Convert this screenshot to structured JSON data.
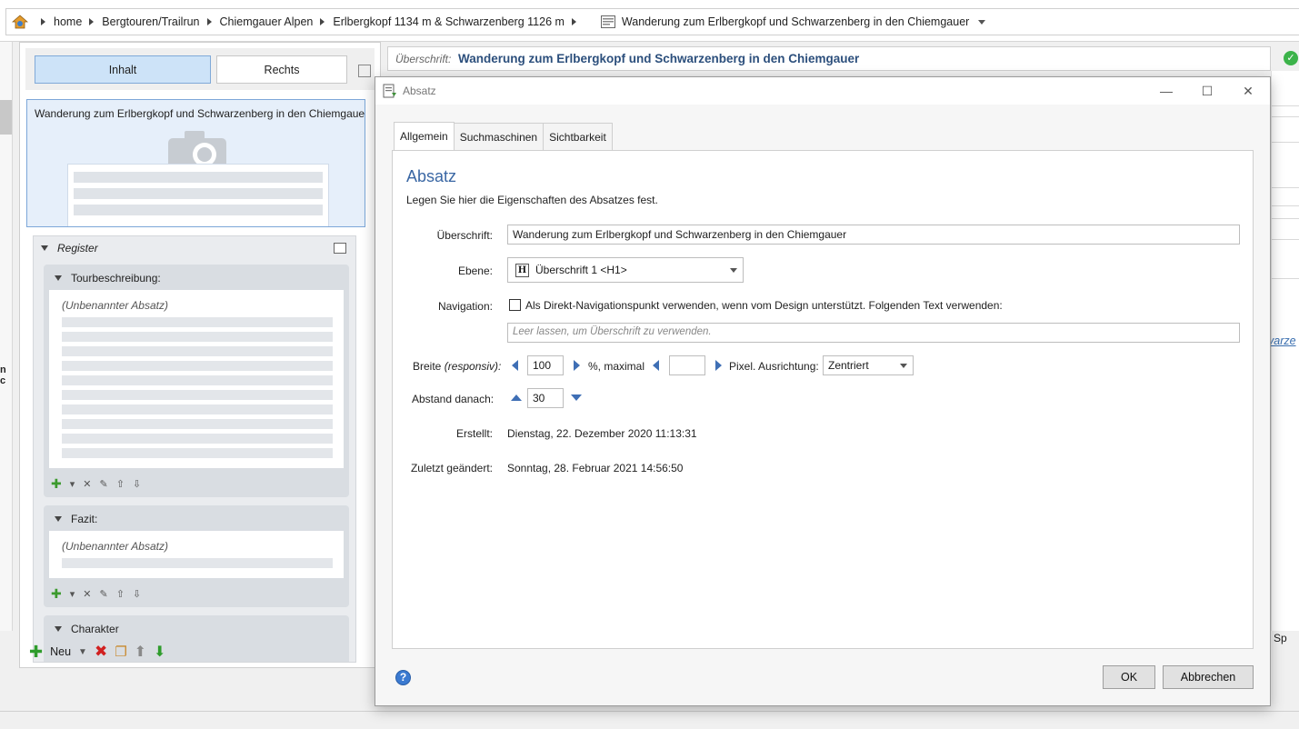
{
  "breadcrumb": {
    "items": [
      "home",
      "Bergtouren/Trailrun",
      "Chiemgauer Alpen",
      "Erlbergkopf 1134 m & Schwarzenberg 1126 m"
    ],
    "current_page": "Wanderung zum Erlbergkopf und Schwarzenberg in den Chiemgauer"
  },
  "left_panel": {
    "tabs": [
      "Inhalt",
      "Rechts"
    ],
    "preview_title": "Wanderung zum Erlbergkopf und Schwarzenberg in den Chiemgaue",
    "register_label": "Register",
    "sections": [
      {
        "title": "Tourbeschreibung:",
        "item": "(Unbenannter Absatz)"
      },
      {
        "title": "Fazit:",
        "item": "(Unbenannter Absatz)"
      },
      {
        "title": "Charakter"
      }
    ],
    "new_label": "Neu",
    "left_strip_cutoff": "n c"
  },
  "background": {
    "heading_label": "Überschrift:",
    "heading_value": "Wanderung zum Erlbergkopf und Schwarzenberg in den Chiemgauer",
    "right_link_fragment": "varze",
    "right_bottom_fragment": "Sp"
  },
  "dialog": {
    "title": "Absatz",
    "tabs": [
      "Allgemein",
      "Suchmaschinen",
      "Sichtbarkeit"
    ],
    "heading": "Absatz",
    "description": "Legen Sie hier die Eigenschaften des Absatzes fest.",
    "fields": {
      "ueberschrift_label": "Überschrift:",
      "ueberschrift_value": "Wanderung zum Erlbergkopf und Schwarzenberg in den Chiemgauer",
      "ebene_label": "Ebene:",
      "ebene_value": "Überschrift 1  <H1>",
      "ebene_icon_letter": "H",
      "navigation_label": "Navigation:",
      "navigation_checkbox_text": "Als Direkt-Navigationspunkt verwenden, wenn vom Design unterstützt. Folgenden Text verwenden:",
      "navigation_placeholder": "Leer lassen, um Überschrift zu verwenden.",
      "breite_label": "Breite",
      "breite_label_italic": "(responsiv):",
      "breite_value": "100",
      "breite_unit": "%, maximal",
      "pixel_label": "Pixel. Ausrichtung:",
      "ausrichtung_value": "Zentriert",
      "abstand_label": "Abstand danach:",
      "abstand_value": "30",
      "erstellt_label": "Erstellt:",
      "erstellt_value": "Dienstag, 22. Dezember 2020 11:13:31",
      "geaendert_label": "Zuletzt geändert:",
      "geaendert_value": "Sonntag, 28. Februar 2021 14:56:50"
    },
    "buttons": {
      "ok": "OK",
      "cancel": "Abbrechen",
      "help": "?"
    }
  },
  "colors": {
    "accent": "#3a67a4",
    "tab_active": "#cde3f8",
    "success": "#3cb34a"
  }
}
